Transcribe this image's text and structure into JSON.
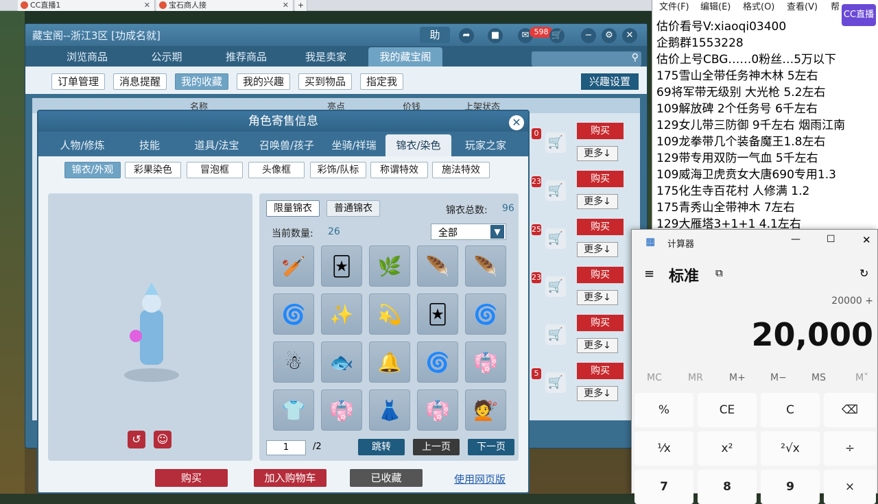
{
  "browser_tabs": [
    {
      "label": "CC直播1"
    },
    {
      "label": "宝石商人接"
    }
  ],
  "game": {
    "window_title": "藏宝阁--浙江3区 [功成名就]",
    "help_label": "助",
    "message_count": "598",
    "nav_tabs": [
      "浏览商品",
      "公示期",
      "推荐商品",
      "我是卖家",
      "我的藏宝阁"
    ],
    "sub_tabs": [
      "订单管理",
      "消息提醒",
      "我的收藏",
      "我的兴趣",
      "买到物品",
      "指定我"
    ],
    "interest_button": "兴趣设置",
    "list_headers": [
      "名称",
      "亮点",
      "价钱",
      "上架状态"
    ],
    "row_numbers": [
      "0",
      "23",
      "25",
      "23",
      "",
      "5"
    ],
    "buy_label": "购买",
    "more_label": "更多↓"
  },
  "dialog": {
    "title": "角色寄售信息",
    "tabs": [
      "人物/修炼",
      "技能",
      "道具/法宝",
      "召唤兽/孩子",
      "坐骑/祥瑞",
      "锦衣/染色",
      "玩家之家"
    ],
    "sub_tabs": [
      "锦衣/外观",
      "彩果染色",
      "冒泡框",
      "头像框",
      "彩饰/队标",
      "称谓特效",
      "施法特效"
    ],
    "limited_label": "限量锦衣",
    "normal_label": "普通锦衣",
    "total_label": "锦衣总数:",
    "total_value": "96",
    "current_label": "当前数量:",
    "current_value": "26",
    "filter_value": "全部",
    "page_current": "1",
    "page_total": "/2",
    "jump_label": "跳转",
    "prev_label": "上一页",
    "next_label": "下一页",
    "buy_label": "购买",
    "cart_label": "加入购物车",
    "fav_label": "已收藏",
    "web_label": "使用网页版"
  },
  "notepad": {
    "menu": [
      "文件(F)",
      "编辑(E)",
      "格式(O)",
      "查看(V)",
      "帮"
    ],
    "brand": "CC直播",
    "lines": [
      "估价看号V:xiaoqi03400",
      "企鹅群1553228",
      "估价上号CBG……0粉丝…5万以下",
      "175雪山全带任务神木林 5左右",
      "69将军带无级别 大光枪 5.2左右",
      "109解放碑 2个任务号 6千左右",
      "129女儿带三防御 9千左右 烟雨江南",
      "109龙拳带几个装备魔王1.8左右",
      "129带专用双防一气血 5千左右",
      "109威海卫虎贲女大唐690专用1.3",
      "175化生寺百花村 人修满 1.2",
      "175青秀山全带神木  7左右",
      "129大雁塔3+1+1  4.1左右"
    ]
  },
  "calculator": {
    "title": "计算器",
    "mode": "标准",
    "expression": "20000 +",
    "display": "20,000",
    "memory": [
      "MC",
      "MR",
      "M+",
      "M−",
      "MS",
      "M˅"
    ],
    "keys": [
      "%",
      "CE",
      "C",
      "⌫",
      "¹⁄x",
      "x²",
      "²√x",
      "÷",
      "7",
      "8",
      "9",
      "×"
    ]
  }
}
